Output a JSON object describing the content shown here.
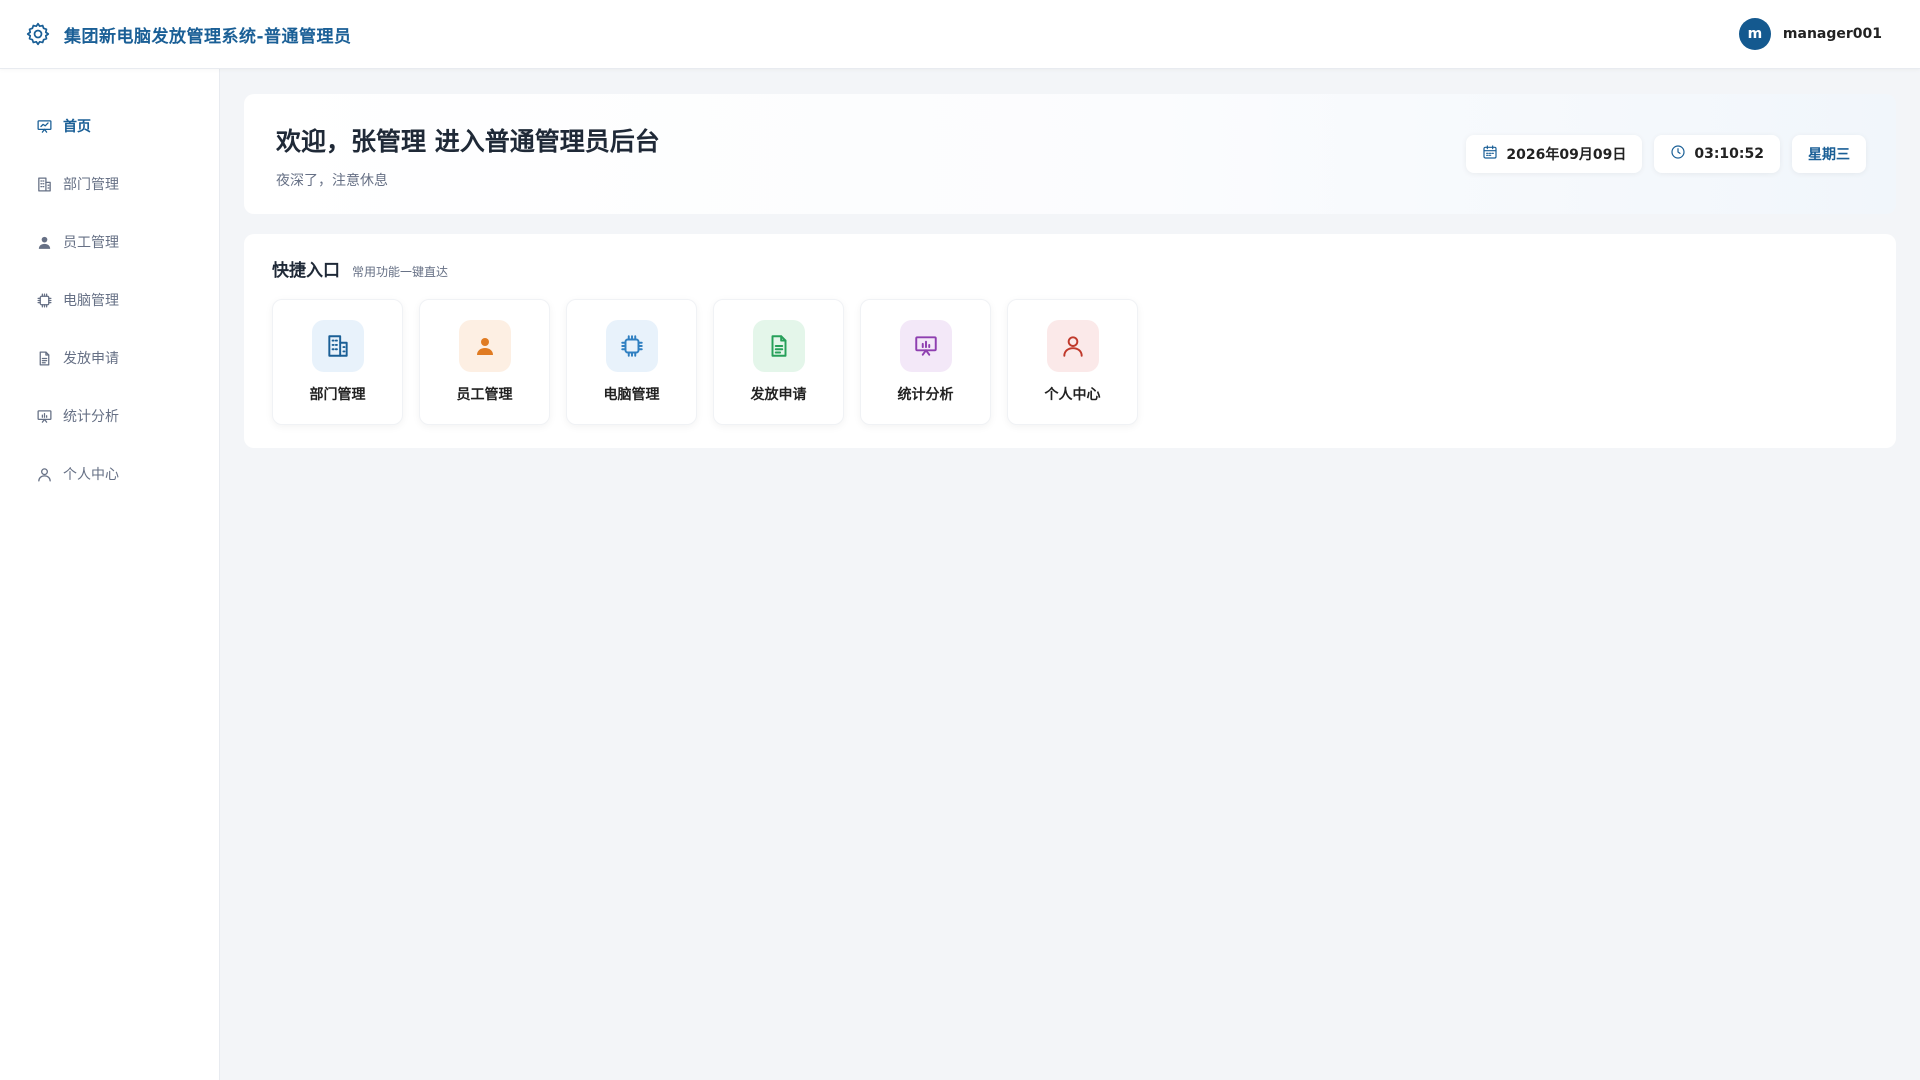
{
  "header": {
    "title": "集团新电脑发放管理系统-普通管理员",
    "brand_icon": "gear-icon",
    "brand_color": "#1a5f96",
    "user": {
      "avatar_letter": "m",
      "username": "manager001",
      "avatar_color": "#14598f"
    }
  },
  "sidebar": {
    "items": [
      {
        "label": "首页",
        "icon": "presentation-chart-icon",
        "active": true
      },
      {
        "label": "部门管理",
        "icon": "building-icon",
        "active": false
      },
      {
        "label": "员工管理",
        "icon": "user-icon",
        "active": false
      },
      {
        "label": "电脑管理",
        "icon": "cpu-chip-icon",
        "active": false
      },
      {
        "label": "发放申请",
        "icon": "document-icon",
        "active": false
      },
      {
        "label": "统计分析",
        "icon": "presentation-chart-icon",
        "active": false
      },
      {
        "label": "个人中心",
        "icon": "user-outline-icon",
        "active": false
      }
    ]
  },
  "welcome": {
    "title": "欢迎，张管理 进入普通管理员后台",
    "subtitle": "夜深了，注意休息",
    "date": "2026年09月09日",
    "time": "03:10:52",
    "weekday": "星期三"
  },
  "quick": {
    "title": "快捷入口",
    "subtitle": "常用功能一键直达",
    "cards": [
      {
        "label": "部门管理",
        "icon": "building-icon",
        "color": "#1a5f96",
        "bg": "#e8f2fb"
      },
      {
        "label": "员工管理",
        "icon": "user-icon",
        "color": "#e07b22",
        "bg": "#fdefe3"
      },
      {
        "label": "电脑管理",
        "icon": "cpu-chip-icon",
        "color": "#2f7fc1",
        "bg": "#e8f2fb"
      },
      {
        "label": "发放申请",
        "icon": "document-icon",
        "color": "#27a05a",
        "bg": "#e4f6ea"
      },
      {
        "label": "统计分析",
        "icon": "presentation-chart-icon",
        "color": "#8e3fb0",
        "bg": "#f3e8f8"
      },
      {
        "label": "个人中心",
        "icon": "user-outline-icon",
        "color": "#c0392b",
        "bg": "#fbe9e9"
      }
    ]
  }
}
